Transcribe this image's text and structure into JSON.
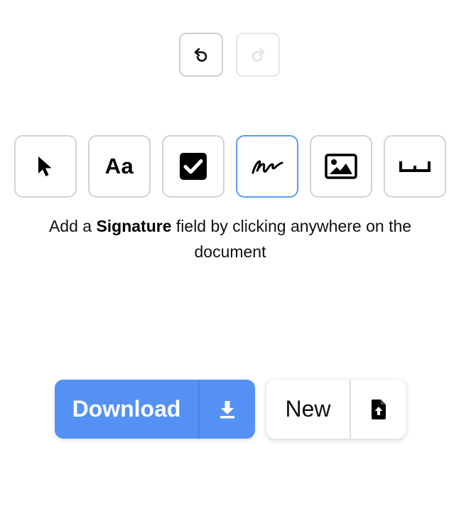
{
  "history": {
    "undo_icon": "undo-icon",
    "redo_icon": "redo-icon",
    "redo_disabled": true
  },
  "tools": [
    {
      "name": "select",
      "icon": "cursor-icon"
    },
    {
      "name": "text",
      "icon": "text-icon",
      "label": "Aa"
    },
    {
      "name": "checkbox",
      "icon": "checkbox-icon"
    },
    {
      "name": "signature",
      "icon": "signature-icon",
      "selected": true
    },
    {
      "name": "image",
      "icon": "image-icon"
    },
    {
      "name": "space",
      "icon": "space-icon"
    }
  ],
  "instruction": {
    "prefix": "Add a",
    "field_name": "Signature",
    "suffix": "field by clicking anywhere on the document"
  },
  "actions": {
    "download_label": "Download",
    "download_icon": "download-icon",
    "new_label": "New",
    "new_icon": "file-upload-icon"
  },
  "colors": {
    "accent": "#5591f5",
    "selected_border": "#5b9cf0",
    "tool_border": "#d3d3d3"
  }
}
